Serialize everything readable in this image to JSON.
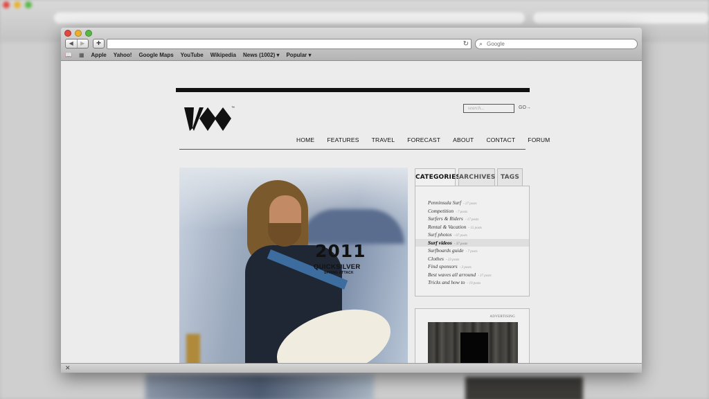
{
  "browser": {
    "back": "◀",
    "forward": "▶",
    "new_tab": "+",
    "reload": "↻",
    "search_placeholder": "Google",
    "bookmarks": [
      "Apple",
      "Yahoo!",
      "Google Maps",
      "YouTube",
      "Wikipedia",
      "News (1002) ▾",
      "Popular ▾"
    ],
    "status_close": "✕"
  },
  "site": {
    "logo_mark": "™",
    "search_placeholder": "search...",
    "go_label": "GO→",
    "nav": [
      "HOME",
      "FEATURES",
      "TRAVEL",
      "FORECAST",
      "ABOUT",
      "CONTACT",
      "FORUM"
    ]
  },
  "hero": {
    "year": "2011",
    "brand": "QUICKSILVER",
    "tagline": "SPRING ATTACK"
  },
  "sidebar": {
    "tabs": [
      "CATEGORIES",
      "ARCHIVES",
      "TAGS"
    ],
    "categories": [
      {
        "name": "Penninsula Surf",
        "count": "- 27 posts"
      },
      {
        "name": "Competition",
        "count": "- 7 posts"
      },
      {
        "name": "Surfers & Riders",
        "count": "- 17 posts"
      },
      {
        "name": "Rental & Vacation",
        "count": "- 15 posts"
      },
      {
        "name": "Surf photos",
        "count": "- 67 posts"
      },
      {
        "name": "Surf videos",
        "count": "- 37 posts"
      },
      {
        "name": "Surfboards guide",
        "count": "- 7 posts"
      },
      {
        "name": "Clothes",
        "count": "- 23 posts"
      },
      {
        "name": "Find sponsors",
        "count": "- 3 posts"
      },
      {
        "name": "Best waves all arround",
        "count": "- 37 posts"
      },
      {
        "name": "Tricks and how to",
        "count": "- 19 posts"
      }
    ],
    "active_category": "Surf videos",
    "ad_label": "ADVERTISING"
  },
  "colors": {
    "accent_dark": "#111111",
    "traffic_red": "#e0473f",
    "traffic_yellow": "#e9b12b",
    "traffic_green": "#58b844"
  }
}
